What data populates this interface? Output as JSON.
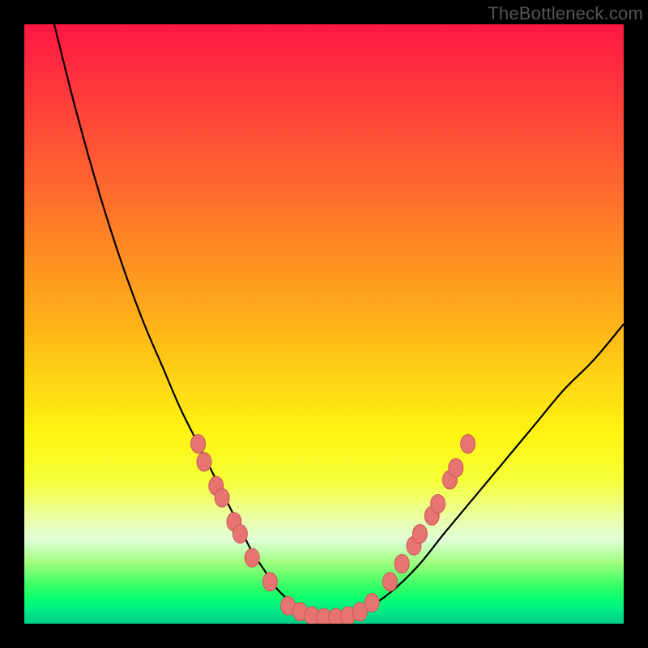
{
  "watermark": "TheBottleneck.com",
  "colors": {
    "background": "#000000",
    "gradient_top": "#ff1744",
    "gradient_mid": "#fff312",
    "gradient_bottom": "#00cc88",
    "curve_stroke": "#000000",
    "marker_fill": "#e77471",
    "marker_stroke": "#c85a58"
  },
  "chart_data": {
    "type": "line",
    "title": "",
    "xlabel": "",
    "ylabel": "",
    "xlim": [
      0,
      100
    ],
    "ylim": [
      0,
      100
    ],
    "grid": false,
    "legend": false,
    "series": [
      {
        "name": "bottleneck-curve",
        "x": [
          5,
          8,
          11,
          14,
          17,
          20,
          23,
          26,
          29,
          32,
          34,
          36,
          38,
          40,
          42,
          44,
          46,
          50,
          54,
          58,
          62,
          66,
          70,
          75,
          80,
          85,
          90,
          95,
          100
        ],
        "values": [
          100,
          88,
          77,
          67,
          58,
          50,
          43,
          36,
          30,
          24,
          20,
          16,
          12,
          9,
          6,
          4,
          2,
          1,
          1,
          3,
          6,
          10,
          15,
          21,
          27,
          33,
          39,
          44,
          50
        ]
      }
    ],
    "markers": [
      {
        "x": 29,
        "y": 30
      },
      {
        "x": 30,
        "y": 27
      },
      {
        "x": 32,
        "y": 23
      },
      {
        "x": 33,
        "y": 21
      },
      {
        "x": 35,
        "y": 17
      },
      {
        "x": 36,
        "y": 15
      },
      {
        "x": 38,
        "y": 11
      },
      {
        "x": 41,
        "y": 7
      },
      {
        "x": 44,
        "y": 3
      },
      {
        "x": 46,
        "y": 2
      },
      {
        "x": 48,
        "y": 1.3
      },
      {
        "x": 50,
        "y": 1
      },
      {
        "x": 52,
        "y": 1
      },
      {
        "x": 54,
        "y": 1.3
      },
      {
        "x": 56,
        "y": 2
      },
      {
        "x": 58,
        "y": 3.5
      },
      {
        "x": 61,
        "y": 7
      },
      {
        "x": 63,
        "y": 10
      },
      {
        "x": 65,
        "y": 13
      },
      {
        "x": 66,
        "y": 15
      },
      {
        "x": 68,
        "y": 18
      },
      {
        "x": 69,
        "y": 20
      },
      {
        "x": 71,
        "y": 24
      },
      {
        "x": 72,
        "y": 26
      },
      {
        "x": 74,
        "y": 30
      }
    ]
  }
}
